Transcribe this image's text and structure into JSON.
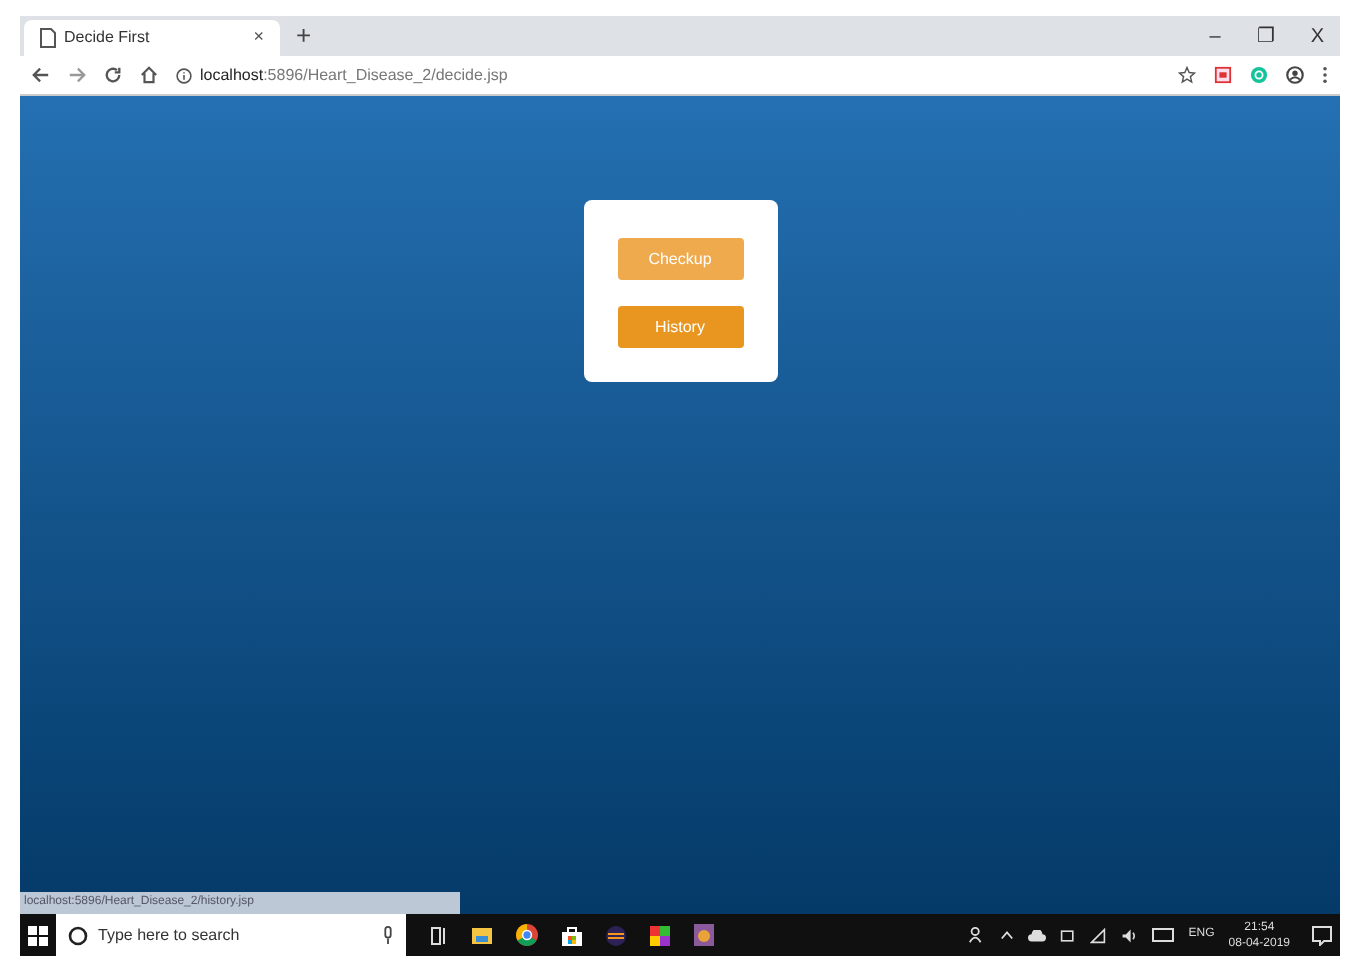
{
  "browser": {
    "tab_title": "Decide First",
    "tab_close": "×",
    "new_tab": "+",
    "url_host": "localhost",
    "url_rest": ":5896/Heart_Disease_2/decide.jsp",
    "window_controls": [
      "–",
      "❐",
      "X"
    ]
  },
  "card": {
    "buttons": [
      {
        "label": "Checkup",
        "color": "#eeaa4c"
      },
      {
        "label": "History",
        "color": "#e8961f"
      }
    ]
  },
  "status_url": "localhost:5896/Heart_Disease_2/history.jsp",
  "taskbar": {
    "search_placeholder": "Type here to search",
    "language": "ENG",
    "time": "21:54",
    "date": "08-04-2019"
  }
}
